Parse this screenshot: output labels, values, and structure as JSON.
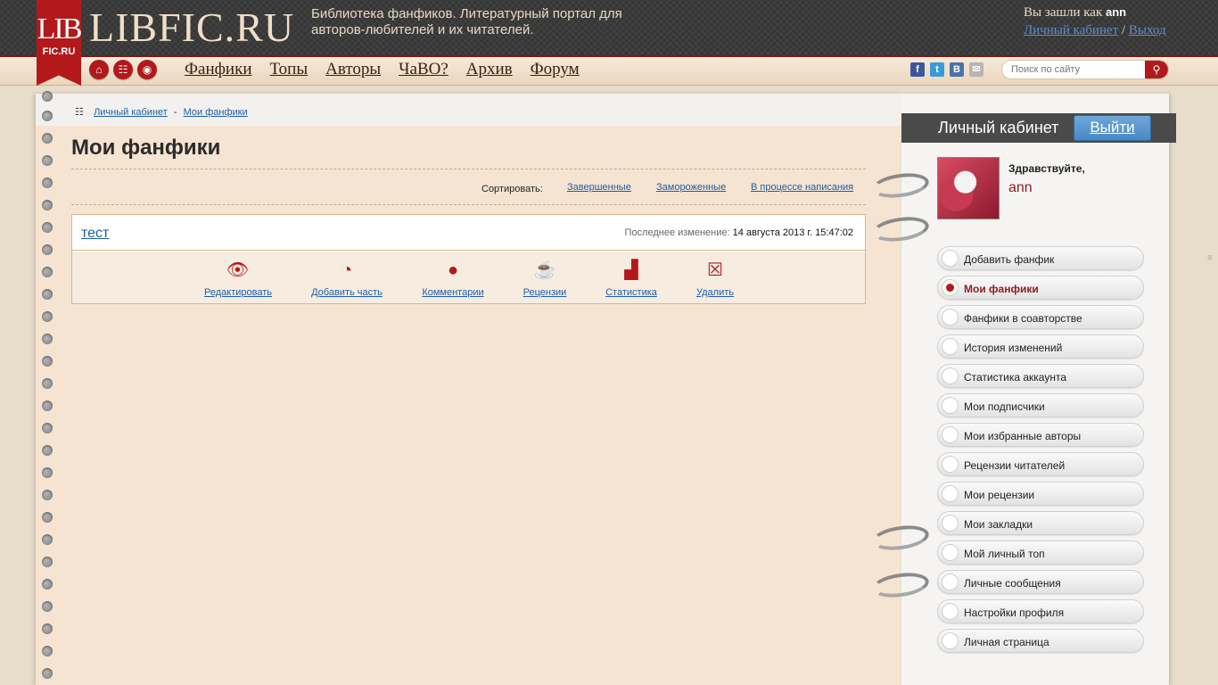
{
  "header": {
    "logo_top": "LIB",
    "logo_bottom": "FIC.RU",
    "site_name": "LIBFIC.RU",
    "tagline": "Библиотека фанфиков. Литературный портал для авторов-любителей и их читателей.",
    "logged_in_prefix": "Вы зашли как",
    "username": "ann",
    "cabinet_link": "Личный кабинет",
    "separator": "/",
    "logout_link": "Выход",
    "search_placeholder": "Поиск по сайту"
  },
  "nav": {
    "items": [
      {
        "label": "Фанфики"
      },
      {
        "label": "Топы"
      },
      {
        "label": "Авторы"
      },
      {
        "label": "ЧаВО?"
      },
      {
        "label": "Архив"
      },
      {
        "label": "Форум"
      }
    ]
  },
  "icons": {
    "home": "home-icon",
    "sitemap": "sitemap-icon",
    "rss": "rss-icon",
    "search": "search-icon"
  },
  "colors": {
    "accent_red": "#b3191b",
    "link_blue": "#1f5ea8"
  },
  "breadcrumb": {
    "items": [
      {
        "label": "Личный кабинет"
      },
      {
        "label": "Мои фанфики"
      }
    ],
    "separator": "-"
  },
  "main": {
    "title": "Мои фанфики",
    "sort_label": "Сортировать:",
    "sort_options": [
      {
        "label": "Завершенные"
      },
      {
        "label": "Замороженные"
      },
      {
        "label": "В процессе написания"
      }
    ],
    "fanfic": {
      "title": "тест",
      "modified_label": "Последнее изменение:",
      "modified_value": "14 августа 2013 г. 15:47:02",
      "actions": [
        {
          "label": "Редактировать",
          "icon": "eye-icon"
        },
        {
          "label": "Добавить часть",
          "icon": "pie-chart-icon"
        },
        {
          "label": "Комментарии",
          "icon": "comment-icon"
        },
        {
          "label": "Рецензии",
          "icon": "coffee-cup-icon"
        },
        {
          "label": "Статистика",
          "icon": "bar-chart-icon"
        },
        {
          "label": "Удалить",
          "icon": "delete-icon"
        }
      ]
    }
  },
  "sidebar": {
    "title": "Личный кабинет",
    "logout_button": "Выйти",
    "greeting": "Здравствуйте,",
    "username": "ann",
    "menu": [
      {
        "label": "Добавить фанфик",
        "active": false
      },
      {
        "label": "Мои фанфики",
        "active": true
      },
      {
        "label": "Фанфики в соавторстве",
        "active": false
      },
      {
        "label": "История изменений",
        "active": false
      },
      {
        "label": "Статистика аккаунта",
        "active": false
      },
      {
        "label": "Мои подписчики",
        "active": false
      },
      {
        "label": "Мои избранные авторы",
        "active": false
      },
      {
        "label": "Рецензии читателей",
        "active": false
      },
      {
        "label": "Мои рецензии",
        "active": false
      },
      {
        "label": "Мои закладки",
        "active": false
      },
      {
        "label": "Мой личный топ",
        "active": false
      },
      {
        "label": "Личные сообщения",
        "active": false
      },
      {
        "label": "Настройки профиля",
        "active": false
      },
      {
        "label": "Личная страница",
        "active": false
      }
    ]
  }
}
